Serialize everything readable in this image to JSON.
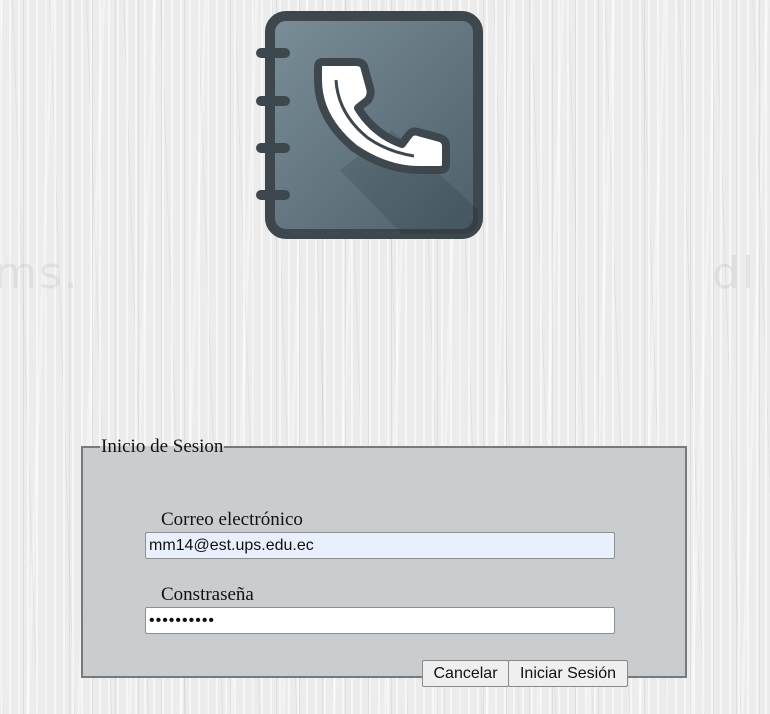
{
  "logo": {
    "icon": "phonebook-icon"
  },
  "form": {
    "legend": "Inicio de Sesion",
    "email_label": "Correo electrónico",
    "email_value": "mm14@est.ups.edu.ec",
    "password_label": "Constraseña",
    "password_value": "••••••••••",
    "cancel_label": "Cancelar",
    "submit_label": "Iniciar Sesión"
  },
  "colors": {
    "panel_background": "#c9cdcf",
    "logo_fill": "#5f7380",
    "logo_border": "#3e474d",
    "autofill_background": "#e8f0fe"
  }
}
